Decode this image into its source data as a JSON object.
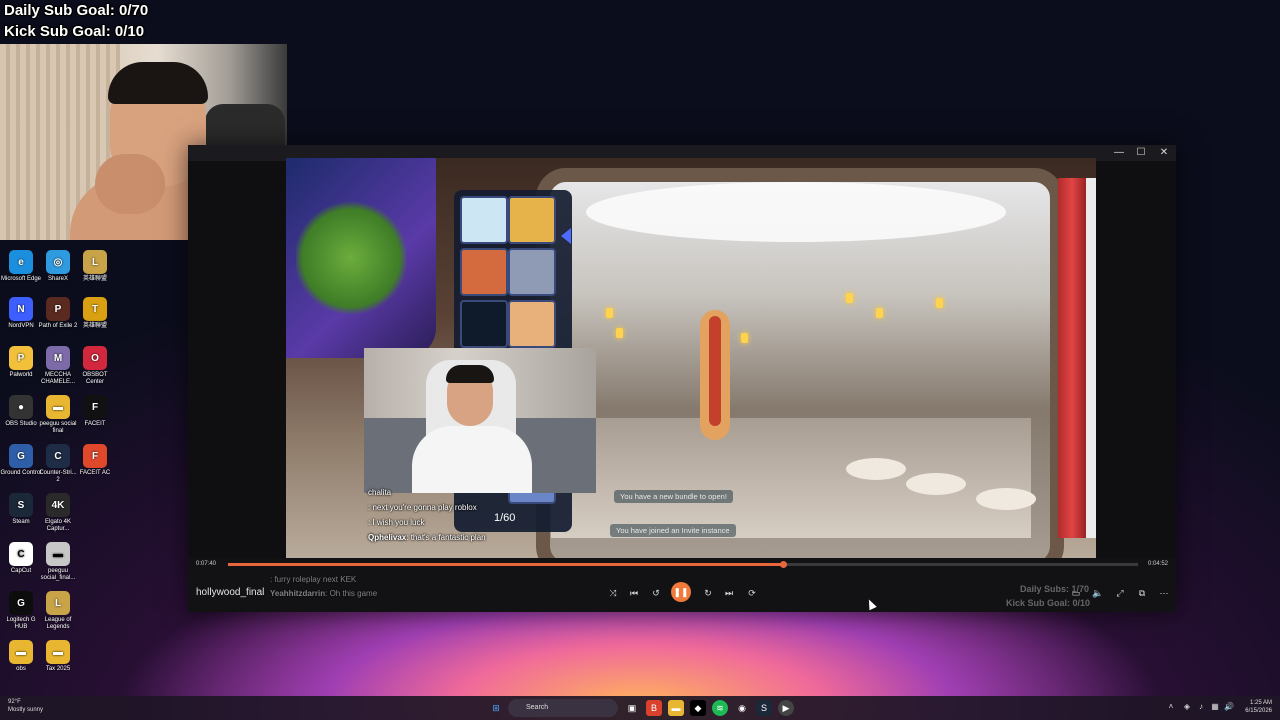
{
  "overlay": {
    "daily_goal": "Daily Sub Goal: 0/70",
    "kick_goal": "Kick Sub Goal: 0/10"
  },
  "desktop": {
    "icons": [
      {
        "label": "Microsoft Edge",
        "glyph": "e",
        "color": "#1b8fdd"
      },
      {
        "label": "ShareX",
        "glyph": "◎",
        "color": "#2e9adf"
      },
      {
        "label": "英雄聯盟",
        "glyph": "L",
        "color": "#c9a347"
      },
      {
        "label": "NordVPN",
        "glyph": "N",
        "color": "#3e5fff"
      },
      {
        "label": "Path of Exile 2",
        "glyph": "P",
        "color": "#5a2a20"
      },
      {
        "label": "英雄聯盟",
        "glyph": "T",
        "color": "#d9a112"
      },
      {
        "label": "Palworld",
        "glyph": "P",
        "color": "#f2c03a"
      },
      {
        "label": "MECCHA CHAMELE...",
        "glyph": "M",
        "color": "#7d6aa8"
      },
      {
        "label": "OBSBOT Center",
        "glyph": "O",
        "color": "#d2283d"
      },
      {
        "label": "OBS Studio",
        "glyph": "●",
        "color": "#333"
      },
      {
        "label": "peeguu social final",
        "glyph": "▬",
        "color": "#e8b630"
      },
      {
        "label": "FACEIT",
        "glyph": "F",
        "color": "#111"
      },
      {
        "label": "Ground Control",
        "glyph": "G",
        "color": "#2e5ea8"
      },
      {
        "label": "Counter-Stri... 2",
        "glyph": "C",
        "color": "#1f2c46"
      },
      {
        "label": "FACEIT AC",
        "glyph": "F",
        "color": "#e0482c"
      },
      {
        "label": "Steam",
        "glyph": "S",
        "color": "#1b2838"
      },
      {
        "label": "Elgato 4K Captur...",
        "glyph": "4K",
        "color": "#2a2a2a"
      },
      {
        "label": "CapCut",
        "glyph": "C",
        "color": "#fff"
      },
      {
        "label": "peeguu social_final...",
        "glyph": "▬",
        "color": "#c7c7c7"
      },
      {
        "label": "Logitech G HUB",
        "glyph": "G",
        "color": "#0d0d0d"
      },
      {
        "label": "League of Legends",
        "glyph": "L",
        "color": "#c9a347"
      },
      {
        "label": "obs",
        "glyph": "▬",
        "color": "#e8b630"
      },
      {
        "label": "Tax 2025",
        "glyph": "▬",
        "color": "#e8b630"
      }
    ]
  },
  "player": {
    "file_name": "hollywood_final",
    "elapsed": "0:07:40",
    "duration": "0:04:52",
    "progress": 0.61,
    "accent": "#e8663c",
    "inventory_count": "1/60",
    "notifications": [
      "You have a new bundle to open!",
      "You have joined an Invite instance"
    ],
    "ghost_daily": "Daily Subs: 1/70",
    "ghost_kick": "Kick Sub Goal: 0/10",
    "chat": [
      {
        "user": "",
        "text": "chalita"
      },
      {
        "user": "",
        "text": ": next you're gonna play roblox"
      },
      {
        "user": "",
        "text": ": I wish you luck"
      },
      {
        "user": "Qphelivax",
        "text": ": that's a fantastic plan"
      },
      {
        "user": "",
        "text": ": furry roleplay next KEK"
      },
      {
        "user": "Yeahhitzdarrin",
        "text": ": Oh this game"
      }
    ],
    "controls": [
      "shuffle-icon",
      "previous-icon",
      "rewind-icon",
      "pause-icon",
      "forward-icon",
      "next-icon",
      "repeat-icon"
    ],
    "right_controls": [
      "captions-icon",
      "volume-icon",
      "fullscreen-icon",
      "miniplayer-icon",
      "more-icon"
    ]
  },
  "taskbar": {
    "weather_temp": "92°F",
    "weather_desc": "Mostly sunny",
    "search_placeholder": "Search",
    "time": "1:25 AM",
    "date": "6/15/2026"
  }
}
